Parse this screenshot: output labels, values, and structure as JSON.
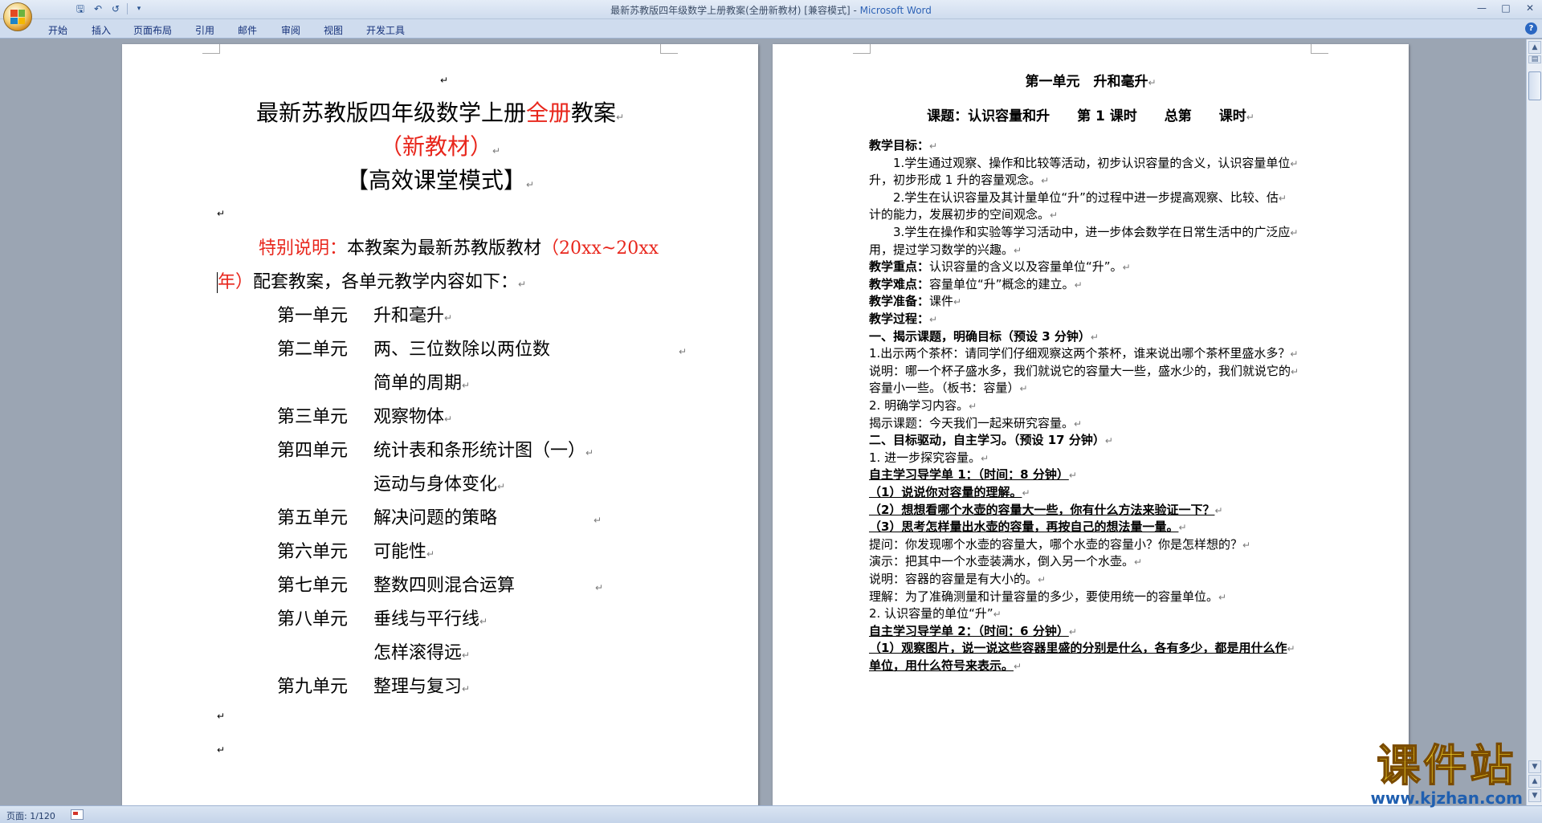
{
  "window": {
    "title": "最新苏教版四年级数学上册教案(全册新教材) [兼容模式]",
    "app_name": "Microsoft Word",
    "title_separator": " - "
  },
  "quick_access": {
    "icons": [
      "save-icon",
      "undo-icon",
      "redo-icon",
      "customize-icon"
    ]
  },
  "ribbon_tabs": [
    "开始",
    "插入",
    "页面布局",
    "引用",
    "邮件",
    "审阅",
    "视图",
    "开发工具"
  ],
  "paragraph_mark": "↵",
  "left_page": {
    "title_line1_a": "最新苏教版四年级数学上册",
    "title_line1_red": "全册",
    "title_line1_b": "教案",
    "title_line2": "（新教材）",
    "title_line3": "【高效课堂模式】",
    "note_label": "特别说明：",
    "note_text": "本教案为最新苏教版教材",
    "note_years": "（20xx~20xx",
    "note_years_end": "年）",
    "note_text2": "配套教案，各单元教学内容如下：",
    "units": [
      {
        "unit": "第一单元",
        "topic": "升和毫升"
      },
      {
        "unit": "第二单元",
        "topic": "两、三位数除以两位数"
      },
      {
        "unit": "",
        "topic": "简单的周期"
      },
      {
        "unit": "第三单元",
        "topic": "观察物体"
      },
      {
        "unit": "第四单元",
        "topic": "统计表和条形统计图（一）"
      },
      {
        "unit": "",
        "topic": "运动与身体变化"
      },
      {
        "unit": "第五单元",
        "topic": "解决问题的策略"
      },
      {
        "unit": "第六单元",
        "topic": "可能性"
      },
      {
        "unit": "第七单元",
        "topic": "整数四则混合运算"
      },
      {
        "unit": "第八单元",
        "topic": "垂线与平行线"
      },
      {
        "unit": "",
        "topic": "怎样滚得远"
      },
      {
        "unit": "第九单元",
        "topic": "整理与复习"
      }
    ]
  },
  "right_page": {
    "heading": "第一单元　升和毫升",
    "subheading": "课题：认识容量和升　　第 1 课时　　总第　　课时",
    "lines": [
      {
        "text": "教学目标：",
        "style": "b"
      },
      {
        "text": "　　1.学生通过观察、操作和比较等活动，初步认识容量的含义，认识容量单位",
        "style": ""
      },
      {
        "text": "升，初步形成 1 升的容量观念。",
        "style": ""
      },
      {
        "text": "　　2.学生在认识容量及其计量单位“升”的过程中进一步提高观察、比较、估",
        "style": ""
      },
      {
        "text": "计的能力，发展初步的空间观念。",
        "style": ""
      },
      {
        "text": "　　3.学生在操作和实验等学习活动中，进一步体会数学在日常生活中的广泛应",
        "style": ""
      },
      {
        "text": "用，提过学习数学的兴趣。",
        "style": ""
      },
      {
        "text": "教学重点：认识容量的含义以及容量单位“升”。",
        "style": "bl"
      },
      {
        "text": "教学难点：容量单位“升”概念的建立。",
        "style": "bl"
      },
      {
        "text": "教学准备：课件",
        "style": "bl"
      },
      {
        "text": "教学过程：",
        "style": "b"
      },
      {
        "text": "一、揭示课题，明确目标（预设 3 分钟）",
        "style": "b"
      },
      {
        "text": "1.出示两个茶杯：请同学们仔细观察这两个茶杯，谁来说出哪个茶杯里盛水多？",
        "style": ""
      },
      {
        "text": "说明：哪一个杯子盛水多，我们就说它的容量大一些，盛水少的，我们就说它的",
        "style": ""
      },
      {
        "text": "容量小一些。（板书：容量）",
        "style": ""
      },
      {
        "text": "2. 明确学习内容。",
        "style": ""
      },
      {
        "text": "揭示课题：今天我们一起来研究容量。",
        "style": ""
      },
      {
        "text": "二、目标驱动，自主学习。（预设 17 分钟）",
        "style": "b"
      },
      {
        "text": "1. 进一步探究容量。",
        "style": ""
      },
      {
        "text": "自主学习导学单 1：（时间：8 分钟）",
        "style": "bu"
      },
      {
        "text": "（1）说说你对容量的理解。",
        "style": "bu"
      },
      {
        "text": "（2）想想看哪个水壶的容量大一些，你有什么方法来验证一下？",
        "style": "bu"
      },
      {
        "text": "（3）思考怎样量出水壶的容量，再按自己的想法量一量。",
        "style": "bu"
      },
      {
        "text": "提问：你发现哪个水壶的容量大，哪个水壶的容量小？你是怎样想的？",
        "style": ""
      },
      {
        "text": "演示：把其中一个水壶装满水，倒入另一个水壶。",
        "style": ""
      },
      {
        "text": "说明：容器的容量是有大小的。",
        "style": ""
      },
      {
        "text": "理解：为了准确测量和计量容量的多少，要使用统一的容量单位。",
        "style": ""
      },
      {
        "text": "2. 认识容量的单位“升”",
        "style": ""
      },
      {
        "text": "自主学习导学单 2：（时间：6 分钟）",
        "style": "bu"
      },
      {
        "text": "（1）观察图片，说一说这些容器里盛的分别是什么，各有多少，都是用什么作",
        "style": "bu"
      },
      {
        "text": "单位，用什么符号来表示。",
        "style": "bu"
      }
    ]
  },
  "status_bar": {
    "page_info": "页面: 1/120"
  },
  "watermark": {
    "title": "课件站",
    "url": "www.kjzhan.com"
  },
  "colors": {
    "accent_red": "#e8261c",
    "workspace": "#9ba5b3",
    "ribbon": "#cfdcee"
  }
}
